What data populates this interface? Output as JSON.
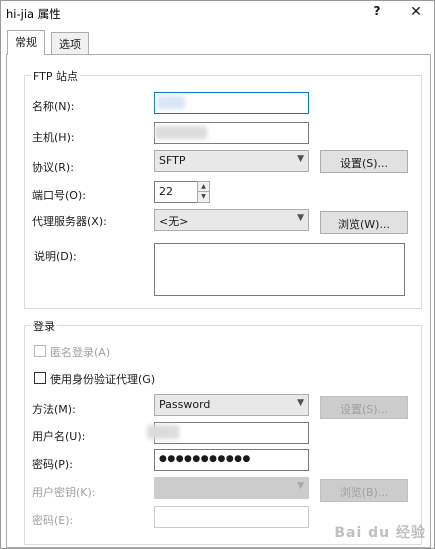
{
  "window": {
    "title": "hi-jia 属性",
    "help_glyph": "?",
    "close_glyph": "✕"
  },
  "tabs": [
    {
      "label": "常规"
    },
    {
      "label": "选项"
    }
  ],
  "ftp_site": {
    "group_title": "FTP 站点",
    "name_label": "名称(N):",
    "host_label": "主机(H):",
    "protocol_label": "协议(R):",
    "protocol_value": "SFTP",
    "settings_button": "设置(S)...",
    "port_label": "端口号(O):",
    "port_value": "22",
    "proxy_label": "代理服务器(X):",
    "proxy_value": "<无>",
    "browse_button": "浏览(W)...",
    "description_label": "说明(D):"
  },
  "login": {
    "group_title": "登录",
    "anonymous_label": "匿名登录(A)",
    "use_agent_label": "使用身份验证代理(G)",
    "method_label": "方法(M):",
    "method_value": "Password",
    "method_settings_button": "设置(S)...",
    "username_label": "用户名(U):",
    "password_label": "密码(P):",
    "password_value": "●●●●●●●●●●●",
    "user_key_label": "用户密钥(K):",
    "key_browse_button": "浏览(B)...",
    "passphrase_label": "密码(E):"
  },
  "watermark": {
    "text": "Bai du 经验"
  },
  "icons": {
    "dropdown": "chevron-down-icon",
    "spin_up": "arrow-up-icon",
    "spin_down": "arrow-down-icon"
  }
}
